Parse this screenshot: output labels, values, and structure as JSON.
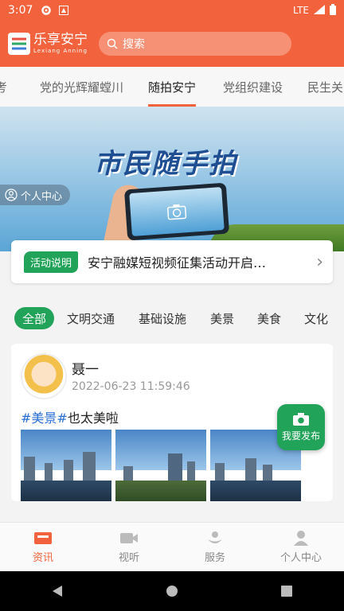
{
  "status": {
    "time": "3:07",
    "network": "LTE"
  },
  "header": {
    "logo_title": "乐享安宁",
    "logo_subtitle": "Lexiang Anning",
    "search_placeholder": "搜索"
  },
  "tabs": [
    {
      "label": "考"
    },
    {
      "label": "党的光辉耀螳川"
    },
    {
      "label": "随拍安宁"
    },
    {
      "label": "党组织建设"
    },
    {
      "label": "民生关"
    }
  ],
  "active_tab": "随拍安宁",
  "banner": {
    "title": "市民随手拍",
    "personal_center": "个人中心"
  },
  "notice": {
    "badge": "活动说明",
    "text": "安宁融媒短视频征集活动开启…",
    "arrow": "›"
  },
  "categories": [
    {
      "label": "全部"
    },
    {
      "label": "文明交通"
    },
    {
      "label": "基础设施"
    },
    {
      "label": "美景"
    },
    {
      "label": "美食"
    },
    {
      "label": "文化"
    }
  ],
  "post": {
    "user": "聂一",
    "time": "2022-06-23 11:59:46",
    "tag1": "#美景#",
    "text": "也太美啦"
  },
  "fab": {
    "label": "我要发布"
  },
  "bottom_nav": [
    {
      "label": "资讯",
      "icon": "news-icon"
    },
    {
      "label": "视听",
      "icon": "video-icon"
    },
    {
      "label": "服务",
      "icon": "service-icon"
    },
    {
      "label": "个人中心",
      "icon": "person-icon"
    }
  ],
  "colors": {
    "accent": "#f2623c",
    "green": "#21a35a"
  }
}
